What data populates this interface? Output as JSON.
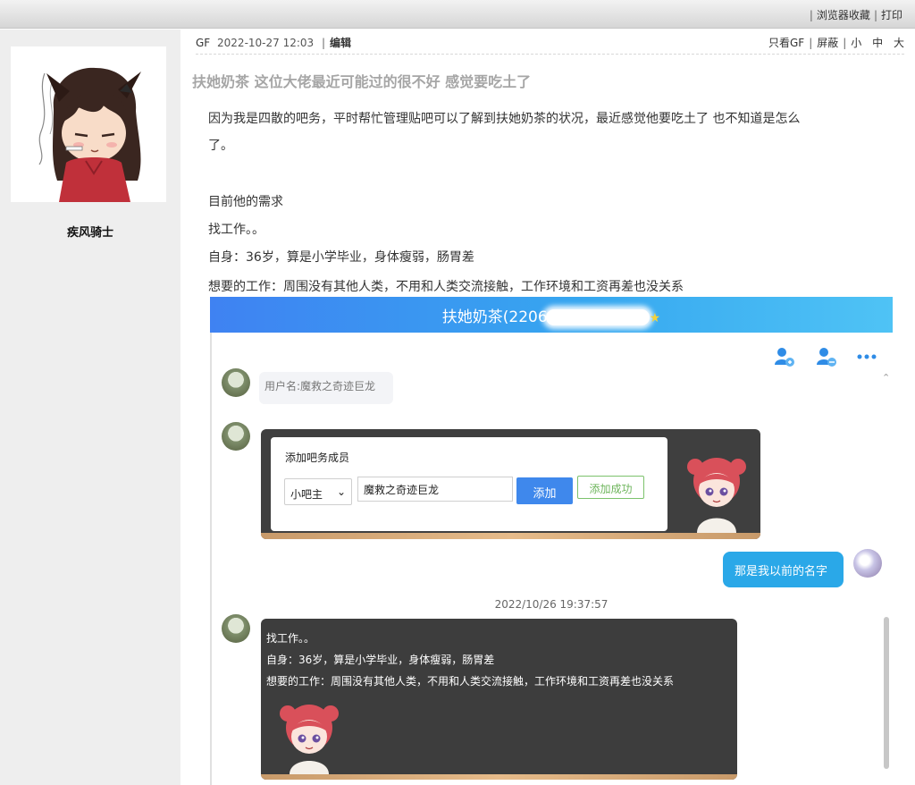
{
  "topbar": {
    "bookmark": "浏览器收藏",
    "print": "打印"
  },
  "author": {
    "name": "疾风骑士"
  },
  "post": {
    "floor": "GF",
    "time": "2022-10-27 12:03",
    "edit": "编辑",
    "only_author": "只看GF",
    "block": "屏蔽",
    "font_small": "小",
    "font_medium": "中",
    "font_large": "大",
    "title": "扶她奶茶 这位大佬最近可能过的很不好 感觉要吃土了",
    "para1_line1": "因为我是四散的吧务，平时帮忙管理贴吧可以了解到扶她奶茶的状况，最近感觉他要吃土了 也不知道是怎么",
    "para1_line2": "了。",
    "needs_title": "目前他的需求",
    "needs_1": "找工作。。",
    "needs_2": "自身：36岁，算是小学毕业，身体瘦弱，肠胃差",
    "needs_3": "想要的工作：周围没有其他人类，不用和人类交流接触，工作环境和工资再差也没关系"
  },
  "chat": {
    "header_title": "扶她奶茶(2206",
    "username_bubble": "用户名:魔救之奇迹巨龙",
    "dialog_title": "添加吧务成员",
    "role_select": "小吧主",
    "name_input": "魔救之奇迹巨龙",
    "add_button": "添加",
    "success_label": "添加成功",
    "my_message": "那是我以前的名字",
    "timestamp": "2022/10/26 19:37:57",
    "msg_line1": "找工作。。",
    "msg_line2": "自身：36岁，算是小学毕业，身体瘦弱，肠胃差",
    "msg_line3": "想要的工作：周围没有其他人类，不用和人类交流接触，工作环境和工资再差也没关系"
  },
  "colors": {
    "sidebar_bg": "#eeeeee",
    "header_blue": "#3f82f2",
    "accent_blue": "#2aa8e8",
    "title_gray": "#a6a6a6"
  }
}
